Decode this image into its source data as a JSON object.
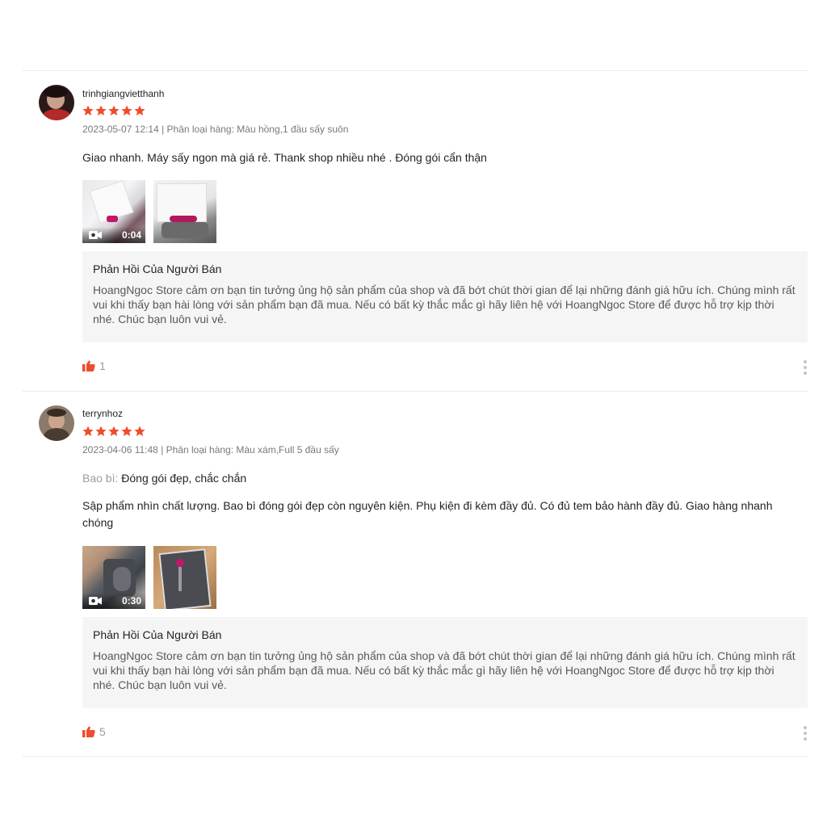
{
  "colors": {
    "accent": "#ee4d2d",
    "reply_bg": "#f5f5f5"
  },
  "reviews": [
    {
      "username": "trinhgiangvietthanh",
      "rating": 5,
      "meta": "2023-05-07 12:14 | Phân loại hàng: Màu hồng,1 đầu sấy suôn",
      "attributes": [],
      "comment": "Giao nhanh. Máy sấy ngon mà giá rẻ. Thank shop nhiều nhé . Đóng gói cẩn thận",
      "media": [
        {
          "type": "video",
          "duration": "0:04",
          "icon": "video-camera-icon"
        },
        {
          "type": "image"
        }
      ],
      "reply": {
        "title": "Phản Hồi Của Người Bán",
        "text": "HoangNgoc Store cảm ơn bạn tin tưởng ủng hộ sản phẩm của shop và đã bớt chút thời gian để lại những đánh giá hữu ích. Chúng mình rất vui khi thấy bạn hài lòng với sản phẩm bạn đã mua. Nếu có bất kỳ thắc mắc gì hãy liên hệ với HoangNgoc Store để được hỗ trợ kịp thời nhé. Chúc bạn luôn vui vẻ."
      },
      "likes": "1"
    },
    {
      "username": "terrynhoz",
      "rating": 5,
      "meta": "2023-04-06 11:48 | Phân loại hàng: Màu xám,Full 5 đầu sấy",
      "attributes": [
        {
          "label": "Bao bì:",
          "value": "Đóng gói đẹp, chắc chắn"
        }
      ],
      "comment": "Sập phẩm nhìn chất lượng. Bao bì đóng gói đẹp còn nguyên kiện. Phụ kiện đi kèm đầy đủ. Có đủ tem bảo hành đầy đủ. Giao hàng nhanh chóng",
      "media": [
        {
          "type": "video",
          "duration": "0:30",
          "icon": "video-camera-icon"
        },
        {
          "type": "image"
        }
      ],
      "reply": {
        "title": "Phản Hồi Của Người Bán",
        "text": "HoangNgoc Store cảm ơn bạn tin tưởng ủng hộ sản phẩm của shop và đã bớt chút thời gian để lại những đánh giá hữu ích. Chúng mình rất vui khi thấy bạn hài lòng với sản phẩm bạn đã mua. Nếu có bất kỳ thắc mắc gì hãy liên hệ với HoangNgoc Store để được hỗ trợ kịp thời nhé. Chúc bạn luôn vui vẻ."
      },
      "likes": "5"
    }
  ]
}
